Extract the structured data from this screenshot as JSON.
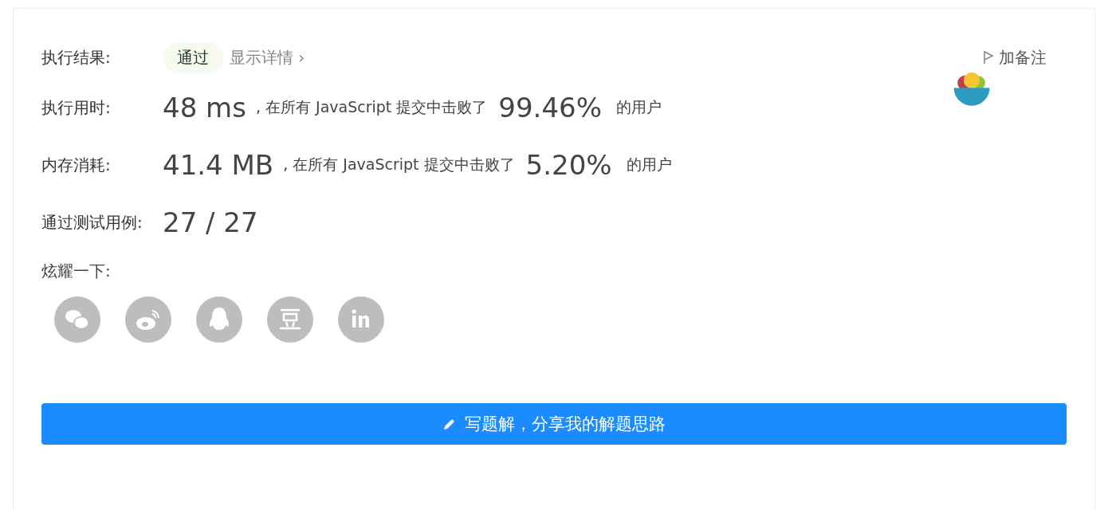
{
  "result": {
    "label": "执行结果:",
    "status": "通过",
    "passed": true,
    "details_link": "显示详情 ›"
  },
  "note_button": {
    "label": "加备注"
  },
  "stats": [
    {
      "label": "执行用时:",
      "value": "48 ms",
      "text": ", 在所有 JavaScript 提交中击败了",
      "percent": "99.46%",
      "suffix": "的用户"
    },
    {
      "label": "内存消耗:",
      "value": "41.4 MB",
      "text": ", 在所有 JavaScript 提交中击败了",
      "percent": "5.20%",
      "suffix": "的用户"
    }
  ],
  "testcases": {
    "label": "通过测试用例:",
    "value": "27 / 27"
  },
  "share": {
    "label": "炫耀一下:",
    "icons": [
      {
        "kind": "wechat"
      },
      {
        "kind": "weibo"
      },
      {
        "kind": "qq"
      },
      {
        "kind": "douban"
      },
      {
        "kind": "linkedin"
      }
    ]
  },
  "solution_button": {
    "label": "写题解，分享我的解题思路"
  }
}
